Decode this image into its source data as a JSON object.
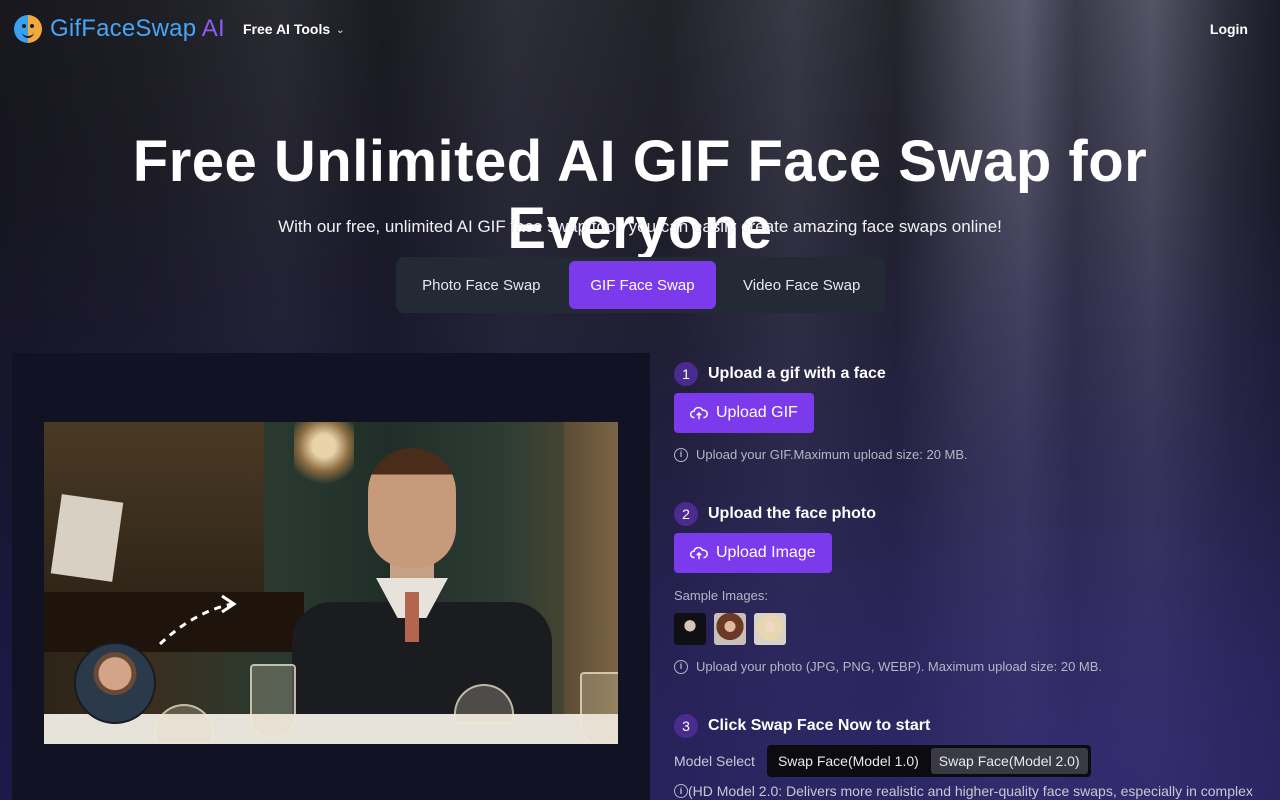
{
  "header": {
    "logo_text_a": "GifFaceSwap",
    "logo_text_b": " AI",
    "tools_label": "Free AI Tools",
    "login_label": "Login"
  },
  "hero": {
    "title": "Free Unlimited AI GIF Face Swap for Everyone",
    "subtitle": "With our free, unlimited AI GIF face swap tool, you can easily create amazing face swaps online!"
  },
  "tabs": [
    {
      "label": "Photo Face Swap",
      "active": false
    },
    {
      "label": "GIF Face Swap",
      "active": true
    },
    {
      "label": "Video Face Swap",
      "active": false
    }
  ],
  "steps": {
    "step1": {
      "num": "1",
      "title": "Upload a gif with a face",
      "button": "Upload GIF",
      "hint": "Upload your GIF.Maximum upload size: 20 MB."
    },
    "step2": {
      "num": "2",
      "title": "Upload the face photo",
      "button": "Upload Image",
      "samples_label": "Sample Images:",
      "hint": "Upload your photo (JPG, PNG, WEBP). Maximum upload size: 20 MB."
    },
    "step3": {
      "num": "3",
      "title": "Click Swap Face Now to start",
      "model_label": "Model Select",
      "models": [
        "Swap Face(Model 1.0)",
        "Swap Face(Model 2.0)"
      ],
      "selected_model": "Swap Face(Model 2.0)",
      "note": "(HD Model 2.0: Delivers more realistic and higher-quality face swaps, especially in complex"
    }
  },
  "colors": {
    "accent": "#7c3aed",
    "step_badge": "#4b2b8f",
    "logo_blue": "#46a6f5",
    "logo_purple": "#8b5cf6"
  },
  "icons": [
    "logo-icon",
    "chevron-down-icon",
    "upload-cloud-icon",
    "info-icon",
    "arrow-icon"
  ]
}
